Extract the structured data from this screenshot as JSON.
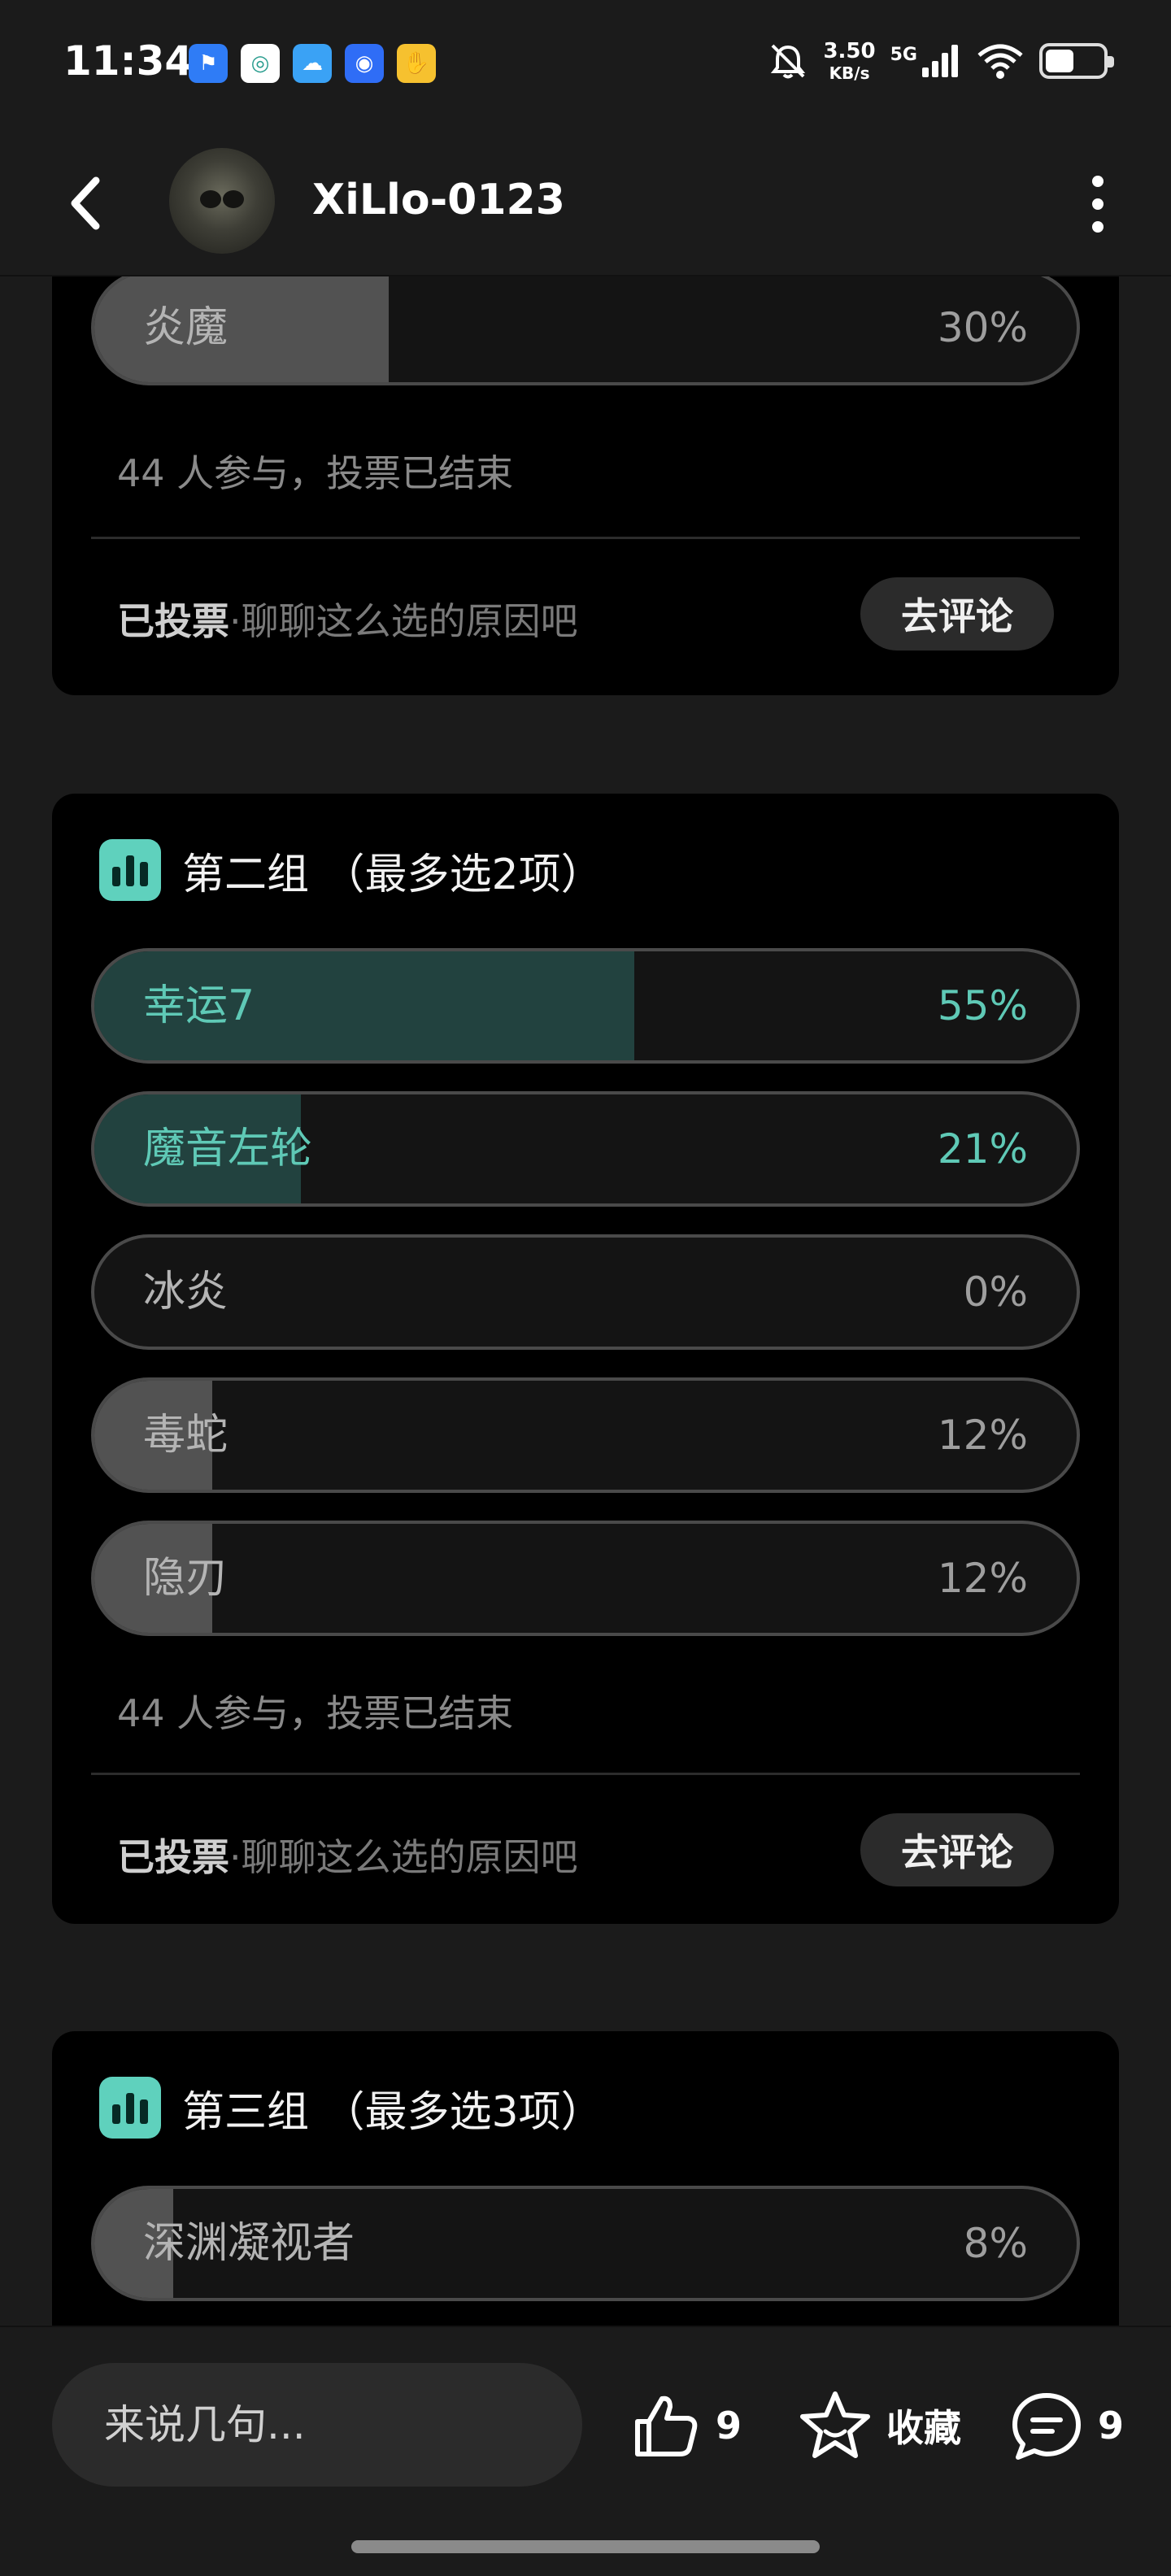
{
  "status_bar": {
    "time": "11:34",
    "net_speed_value": "3.50",
    "net_speed_unit": "KB/s",
    "network": "5G",
    "app_icons": [
      "flag-app-icon",
      "swirl-app-icon",
      "cloud-app-icon",
      "target-app-icon",
      "hand-app-icon"
    ]
  },
  "header": {
    "username": "XiLlo-0123"
  },
  "cards": [
    {
      "options": [
        {
          "label": "炎魔",
          "percent_text": "30%",
          "percent": 30,
          "selected": false
        }
      ],
      "participants": "44 人参与，投票已结束",
      "voted_bold": "已投票",
      "voted_hint": "·聊聊这么选的原因吧",
      "comment_button": "去评论"
    },
    {
      "title": "第二组 （最多选2项）",
      "options": [
        {
          "label": "幸运7",
          "percent_text": "55%",
          "percent": 55,
          "selected": true
        },
        {
          "label": "魔音左轮",
          "percent_text": "21%",
          "percent": 21,
          "selected": true
        },
        {
          "label": "冰炎",
          "percent_text": "0%",
          "percent": 0,
          "selected": false
        },
        {
          "label": "毒蛇",
          "percent_text": "12%",
          "percent": 12,
          "selected": false
        },
        {
          "label": "隐刃",
          "percent_text": "12%",
          "percent": 12,
          "selected": false
        }
      ],
      "participants": "44 人参与，投票已结束",
      "voted_bold": "已投票",
      "voted_hint": "·聊聊这么选的原因吧",
      "comment_button": "去评论"
    },
    {
      "title": "第三组 （最多选3项）",
      "options": [
        {
          "label": "深渊凝视者",
          "percent_text": "8%",
          "percent": 8,
          "selected": false
        }
      ]
    }
  ],
  "bottom_bar": {
    "input_placeholder": "来说几句...",
    "like_count": "9",
    "favorite_label": "收藏",
    "comment_count": "9"
  },
  "colors": {
    "accent": "#5fc9b6",
    "selected_fill": "#22423f",
    "unselected_fill": "#525252"
  }
}
